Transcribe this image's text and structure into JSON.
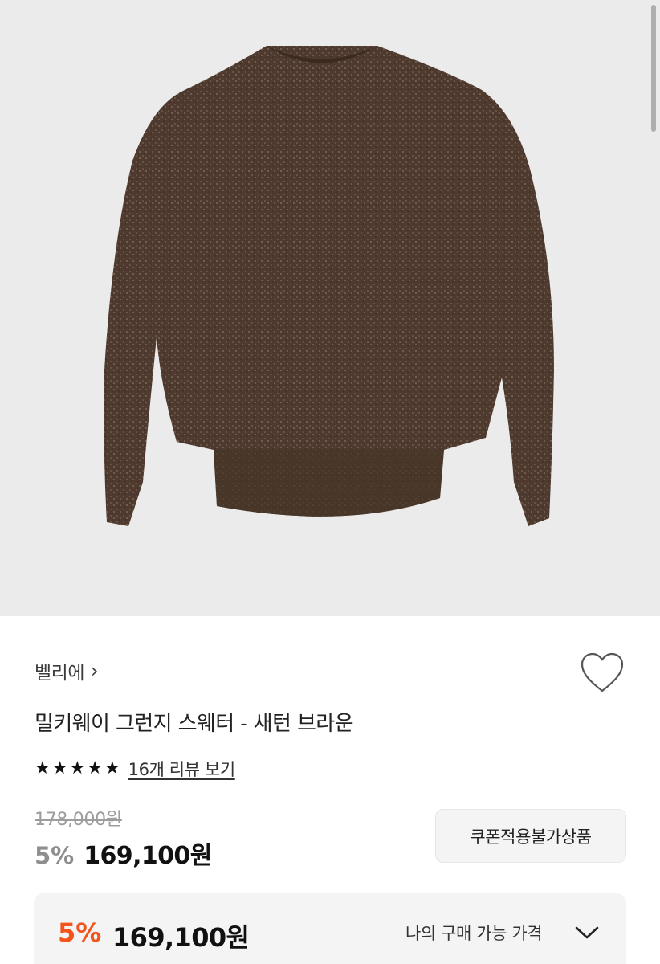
{
  "product": {
    "brand": "벨리에",
    "title": "밀키웨이 그런지 스웨터 - 새턴 브라운",
    "rating_stars": 5,
    "review_link": "16개 리뷰 보기",
    "original_price": "178,000원",
    "discount_percent": "5%",
    "sale_price": "169,100원",
    "coupon_notice": "쿠폰적용불가상품"
  },
  "my_price": {
    "discount_percent": "5%",
    "price": "169,100원",
    "label": "나의 구매 가능 가격"
  },
  "icons": {
    "brand_chevron": "chevron-right-icon",
    "wishlist": "heart-icon",
    "expand": "chevron-down-icon",
    "star": "star-icon"
  },
  "colors": {
    "accent": "#f2541b",
    "sweater": "#4e3a2e",
    "image_bg": "#ecebec"
  }
}
